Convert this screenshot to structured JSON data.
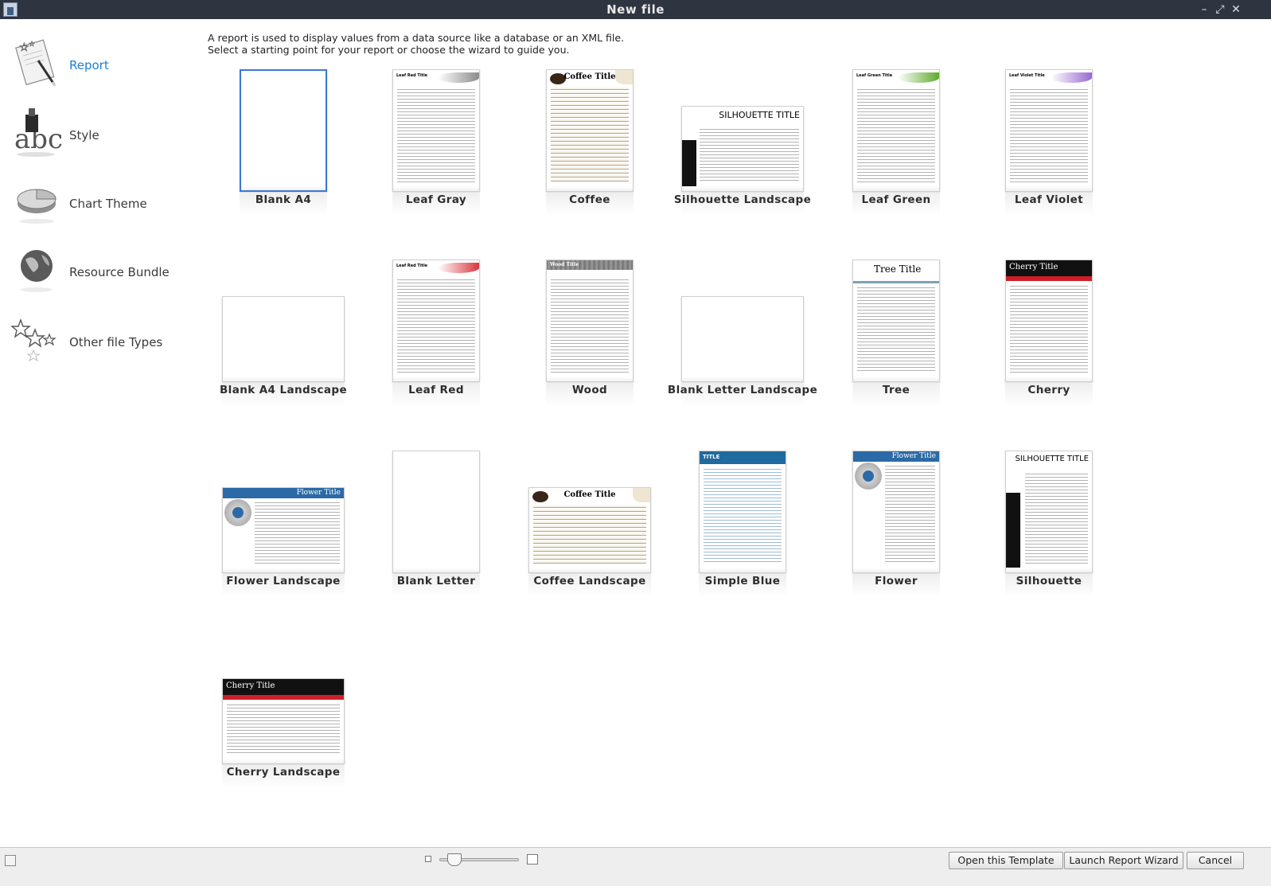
{
  "window": {
    "title": "New file",
    "controls": [
      "minimize-icon",
      "maximize-icon",
      "close-icon"
    ]
  },
  "sidebar": {
    "items": [
      {
        "label": "Report",
        "icon": "report-icon",
        "active": true
      },
      {
        "label": "Style",
        "icon": "style-icon",
        "active": false
      },
      {
        "label": "Chart Theme",
        "icon": "chart-theme-icon",
        "active": false
      },
      {
        "label": "Resource Bundle",
        "icon": "globe-icon",
        "active": false
      },
      {
        "label": "Other file Types",
        "icon": "stars-icon",
        "active": false
      }
    ]
  },
  "description": {
    "line1": "A report is used to display values from a data source like a database or an XML file.",
    "line2": "Select a starting point for your report or choose the wizard to guide you."
  },
  "templates": [
    {
      "name": "Blank A4",
      "style": "blank",
      "selected": true
    },
    {
      "name": "Leaf Gray",
      "style": "leaf",
      "accent": "#8c8c8c",
      "header": "Leaf Red Title"
    },
    {
      "name": "Coffee",
      "style": "coffee",
      "accent": "#c9b48c",
      "header": "Coffee Title"
    },
    {
      "name": "Silhouette Landscape",
      "style": "silhouette",
      "accent": "#111111",
      "header": "SILHOUETTE TITLE"
    },
    {
      "name": "Leaf Green",
      "style": "leaf",
      "accent": "#5faa2a",
      "header": "Leaf Green Title"
    },
    {
      "name": "Leaf Violet",
      "style": "leaf",
      "accent": "#9a6ad0",
      "header": "Leaf Violet Title"
    },
    {
      "name": "Blank A4 Landscape",
      "style": "blank"
    },
    {
      "name": "Leaf Red",
      "style": "leaf",
      "accent": "#d9363e",
      "header": "Leaf Red Title"
    },
    {
      "name": "Wood",
      "style": "wood",
      "accent": "#6e6e6e",
      "header": "Wood Title"
    },
    {
      "name": "Blank Letter Landscape",
      "style": "blank"
    },
    {
      "name": "Tree",
      "style": "tree",
      "accent": "#7fa0b4",
      "header": "Tree Title"
    },
    {
      "name": "Cherry",
      "style": "cherry",
      "accent": "#cc1f2a",
      "header": "Cherry Title"
    },
    {
      "name": "Flower Landscape",
      "style": "flower",
      "accent": "#2b6aa6",
      "header": "Flower Title"
    },
    {
      "name": "Blank Letter",
      "style": "blank"
    },
    {
      "name": "Coffee Landscape",
      "style": "coffee",
      "accent": "#c9b48c",
      "header": "Coffee Title"
    },
    {
      "name": "Simple Blue",
      "style": "simpleblue",
      "accent": "#1f6a9e",
      "header": "TITLE"
    },
    {
      "name": "Flower",
      "style": "flower",
      "accent": "#2b6aa6",
      "header": "Flower Title"
    },
    {
      "name": "Silhouette",
      "style": "silhouette",
      "accent": "#111111",
      "header": "SILHOUETTE TITLE"
    },
    {
      "name": "Cherry Landscape",
      "style": "cherry",
      "accent": "#cc1f2a",
      "header": "Cherry Title"
    }
  ],
  "footer": {
    "buttons": {
      "open": "Open this Template",
      "wizard": "Launch Report Wizard",
      "cancel": "Cancel"
    },
    "zoom_slider_value": 0.1
  },
  "colors": {
    "titlebar": "#2e3440",
    "active_link": "#1a7fd6",
    "selection": "#3a78d4"
  }
}
